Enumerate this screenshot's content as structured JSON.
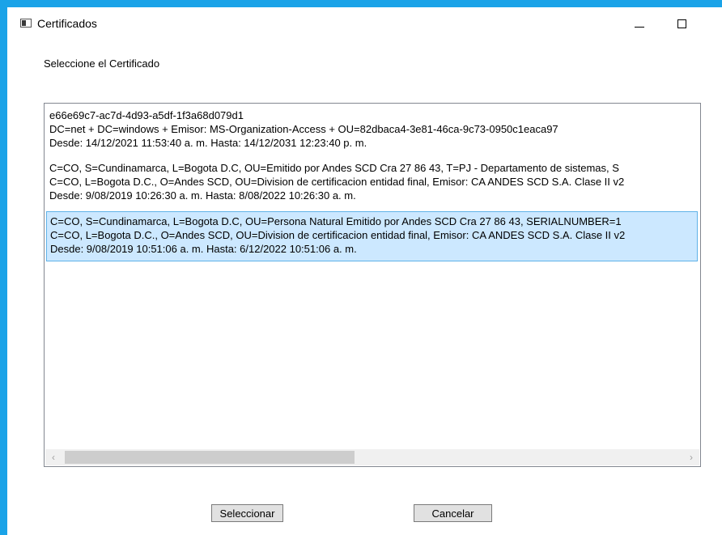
{
  "window": {
    "title": "Certificados",
    "icon": "window-app-icon",
    "controls": [
      "minimize-icon",
      "maximize-icon"
    ]
  },
  "prompt": "Seleccione el Certificado",
  "certificates": [
    {
      "line1": "e66e69c7-ac7d-4d93-a5df-1f3a68d079d1",
      "line2": "DC=net + DC=windows + Emisor: MS-Organization-Access + OU=82dbaca4-3e81-46ca-9c73-0950c1eaca97",
      "line3": "Desde: 14/12/2021 11:53:40 a. m. Hasta: 14/12/2031 12:23:40 p. m."
    },
    {
      "line1": "C=CO, S=Cundinamarca, L=Bogota D.C, OU=Emitido por Andes SCD Cra 27 86 43, T=PJ - Departamento de sistemas, S",
      "line2": "C=CO, L=Bogota D.C., O=Andes SCD, OU=Division de certificacion entidad final, Emisor: CA ANDES SCD S.A. Clase II v2",
      "line3": "Desde: 9/08/2019 10:26:30 a. m. Hasta: 8/08/2022 10:26:30 a. m."
    },
    {
      "line1": "C=CO, S=Cundinamarca, L=Bogota D.C, OU=Persona Natural Emitido por Andes SCD Cra 27 86 43, SERIALNUMBER=1",
      "line2": "C=CO, L=Bogota D.C., O=Andes SCD, OU=Division de certificacion entidad final, Emisor: CA ANDES SCD S.A. Clase II v2",
      "line3": "Desde: 9/08/2019 10:51:06 a. m. Hasta: 6/12/2022 10:51:06 a. m.",
      "selected": true
    }
  ],
  "scrollbar": {
    "left_icon": "chevron-left-icon",
    "right_icon": "chevron-right-icon",
    "left_glyph": "‹",
    "right_glyph": "›"
  },
  "buttons": {
    "select_label": "Seleccionar",
    "cancel_label": "Cancelar"
  },
  "colors": {
    "frame_accent": "#1aa3e8",
    "selection_bg": "#cce8ff",
    "selection_border": "#5fb2e8"
  }
}
